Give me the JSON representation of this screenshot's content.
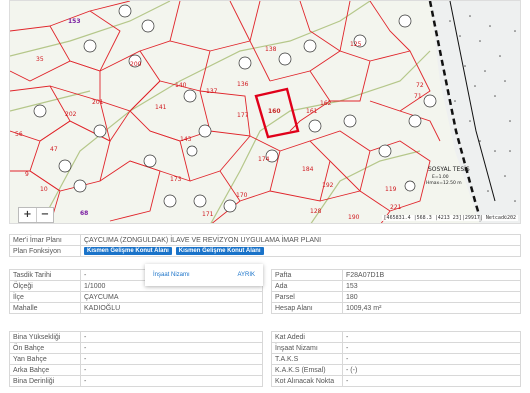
{
  "map": {
    "zoom_in": "+",
    "zoom_out": "−",
    "scale_text": "[465831.4 |568.3 |4213 23]|29917| Netcad©202",
    "labels": {
      "a153": "153",
      "a138": "138",
      "a136": "136",
      "a141": "141",
      "a140": "140",
      "a137": "137",
      "a177": "177",
      "a160": "160",
      "a161": "161",
      "a162": "162",
      "a170": "170",
      "a125": "125",
      "a71": "71",
      "a72": "72",
      "a35": "35",
      "a202": "202",
      "a201": "201",
      "a200": "200",
      "a190": "190",
      "a192": "192",
      "a184": "184",
      "a119": "119",
      "a10": "10",
      "a9": "9",
      "a56": "56",
      "a68": "68",
      "a47": "47",
      "a143": "143",
      "a174": "174",
      "a171": "171",
      "a173": "173",
      "a221": "221",
      "a128": "128"
    },
    "sosyal_label": "SOSYAL TESİS",
    "sosyal_sub1": "E=1.00",
    "sosyal_sub2": "Hmax=12.50 m"
  },
  "plan": {
    "meri_label": "Mer'i İmar Planı",
    "meri_value": "ÇAYCUMA (ZONGULDAK) İLAVE VE REVİZYON UYGULAMA İMAR PLANI",
    "fonksiyon_label": "Plan Fonksiyon",
    "chip1": "Kısmen Gelişme Konut Alanı",
    "chip2": "Kısmen Gelişme Konut Alanı"
  },
  "popup": {
    "title": "İnşaat Nizamı",
    "action": "AYRIK"
  },
  "parcel_left": [
    {
      "label": "Tasdik Tarihi",
      "value": "-"
    },
    {
      "label": "Ölçeği",
      "value": "1/1000"
    },
    {
      "label": "İlçe",
      "value": "ÇAYCUMA"
    },
    {
      "label": "Mahalle",
      "value": "KADIOĞLU"
    }
  ],
  "parcel_right": [
    {
      "label": "Pafta",
      "value": "F28A07D1B"
    },
    {
      "label": "Ada",
      "value": "153"
    },
    {
      "label": "Parsel",
      "value": "180"
    },
    {
      "label": "Hesap Alanı",
      "value": "1009,43 m²"
    }
  ],
  "build_left": [
    {
      "label": "Bina Yüksekliği",
      "value": "-"
    },
    {
      "label": "Ön Bahçe",
      "value": "-"
    },
    {
      "label": "Yan Bahçe",
      "value": "-"
    },
    {
      "label": "Arka Bahçe",
      "value": "-"
    },
    {
      "label": "Bina Derinliği",
      "value": "-"
    }
  ],
  "build_right": [
    {
      "label": "Kat Adedi",
      "value": "-"
    },
    {
      "label": "İnşaat Nizamı",
      "value": "-"
    },
    {
      "label": "T.A.K.S",
      "value": "-"
    },
    {
      "label": "K.A.K.S (Emsal)",
      "value": "- (-)"
    },
    {
      "label": "Kot Alınacak Nokta",
      "value": "-"
    }
  ]
}
